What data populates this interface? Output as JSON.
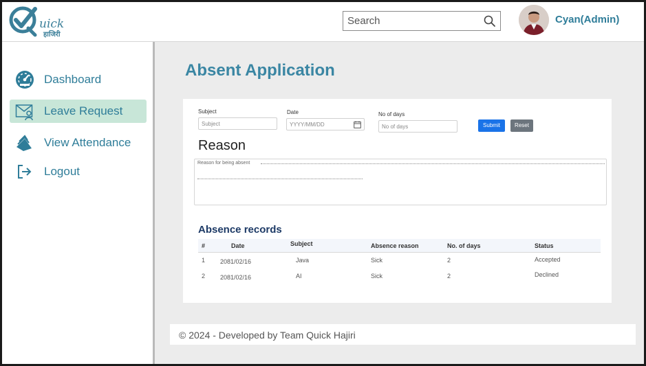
{
  "header": {
    "logo_text": "uick",
    "logo_sub": "हाजिरी",
    "search_placeholder": "Search",
    "user_name": "Cyan(Admin)"
  },
  "sidebar": {
    "items": [
      {
        "label": "Dashboard",
        "icon": "dashboard-icon",
        "active": false
      },
      {
        "label": "Leave Request",
        "icon": "mail-user-icon",
        "active": true
      },
      {
        "label": "View Attendance",
        "icon": "book-icon",
        "active": false
      },
      {
        "label": "Logout",
        "icon": "logout-icon",
        "active": false
      }
    ]
  },
  "main": {
    "title": "Absent Application",
    "form": {
      "subject_label": "Subject",
      "subject_placeholder": "Subject",
      "date_label": "Date",
      "date_placeholder": "YYYY/MM/DD",
      "days_label": "No of  days",
      "days_placeholder": "No of days",
      "submit_label": "Submit",
      "reset_label": "Reset",
      "reason_title": "Reason",
      "reason_placeholder": "Reason for being absent"
    },
    "records": {
      "title": "Absence records",
      "columns": [
        "#",
        "Date",
        "Subject",
        "Absence reason",
        "No. of days",
        "Status"
      ],
      "rows": [
        [
          "1",
          "2081/02/16",
          "Java",
          "Sick",
          "2",
          "Accepted"
        ],
        [
          "2",
          "2081/02/16",
          "AI",
          "Sick",
          "2",
          "Declined"
        ]
      ]
    }
  },
  "footer": {
    "text": "© 2024 - Developed by Team Quick Hajiri"
  },
  "colors": {
    "accent": "#2f7d99",
    "active_nav_bg": "#c8e6d8",
    "submit": "#1a73e8",
    "reset": "#6c757d"
  }
}
